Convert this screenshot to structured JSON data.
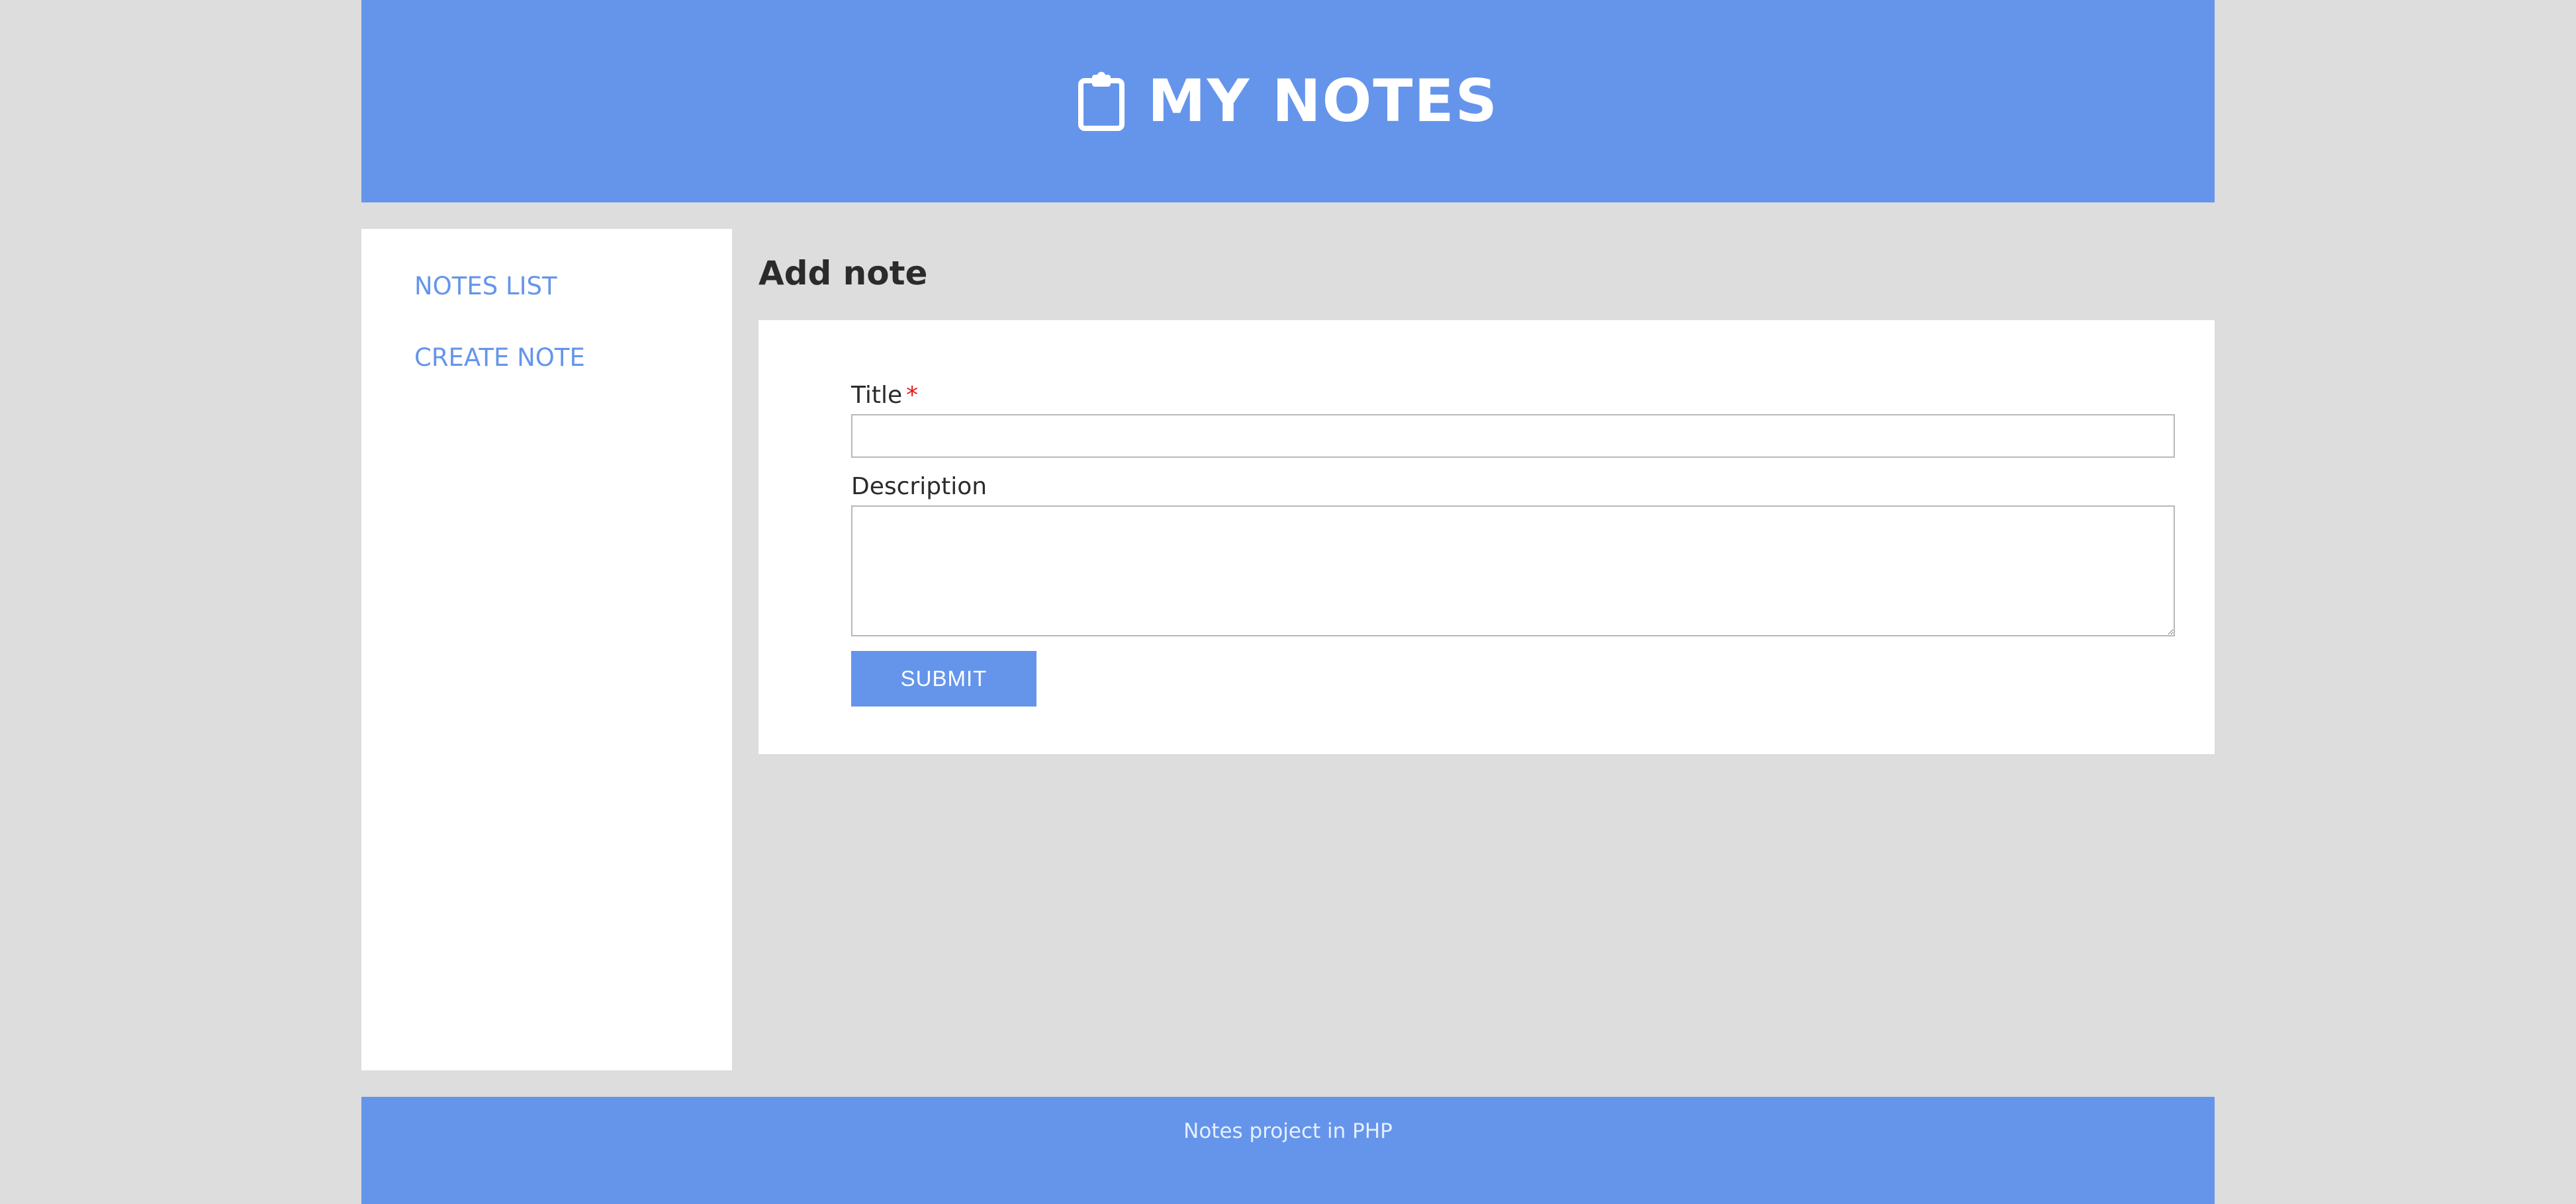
{
  "header": {
    "title": "MY NOTES",
    "icon": "clipboard-icon"
  },
  "sidebar": {
    "items": [
      {
        "label": "NOTES LIST"
      },
      {
        "label": "CREATE NOTE"
      }
    ]
  },
  "main": {
    "heading": "Add note",
    "form": {
      "title_label": "Title",
      "required_marker": "*",
      "title_value": "",
      "title_placeholder": "",
      "description_label": "Description",
      "description_value": "",
      "description_placeholder": "",
      "submit_label": "SUBMIT"
    }
  },
  "footer": {
    "text": "Notes project in PHP"
  },
  "colors": {
    "brand": "#6595eb",
    "background": "#dddddd",
    "panel": "#ffffff",
    "required": "#e11b1b",
    "text": "#2b2b2b"
  }
}
